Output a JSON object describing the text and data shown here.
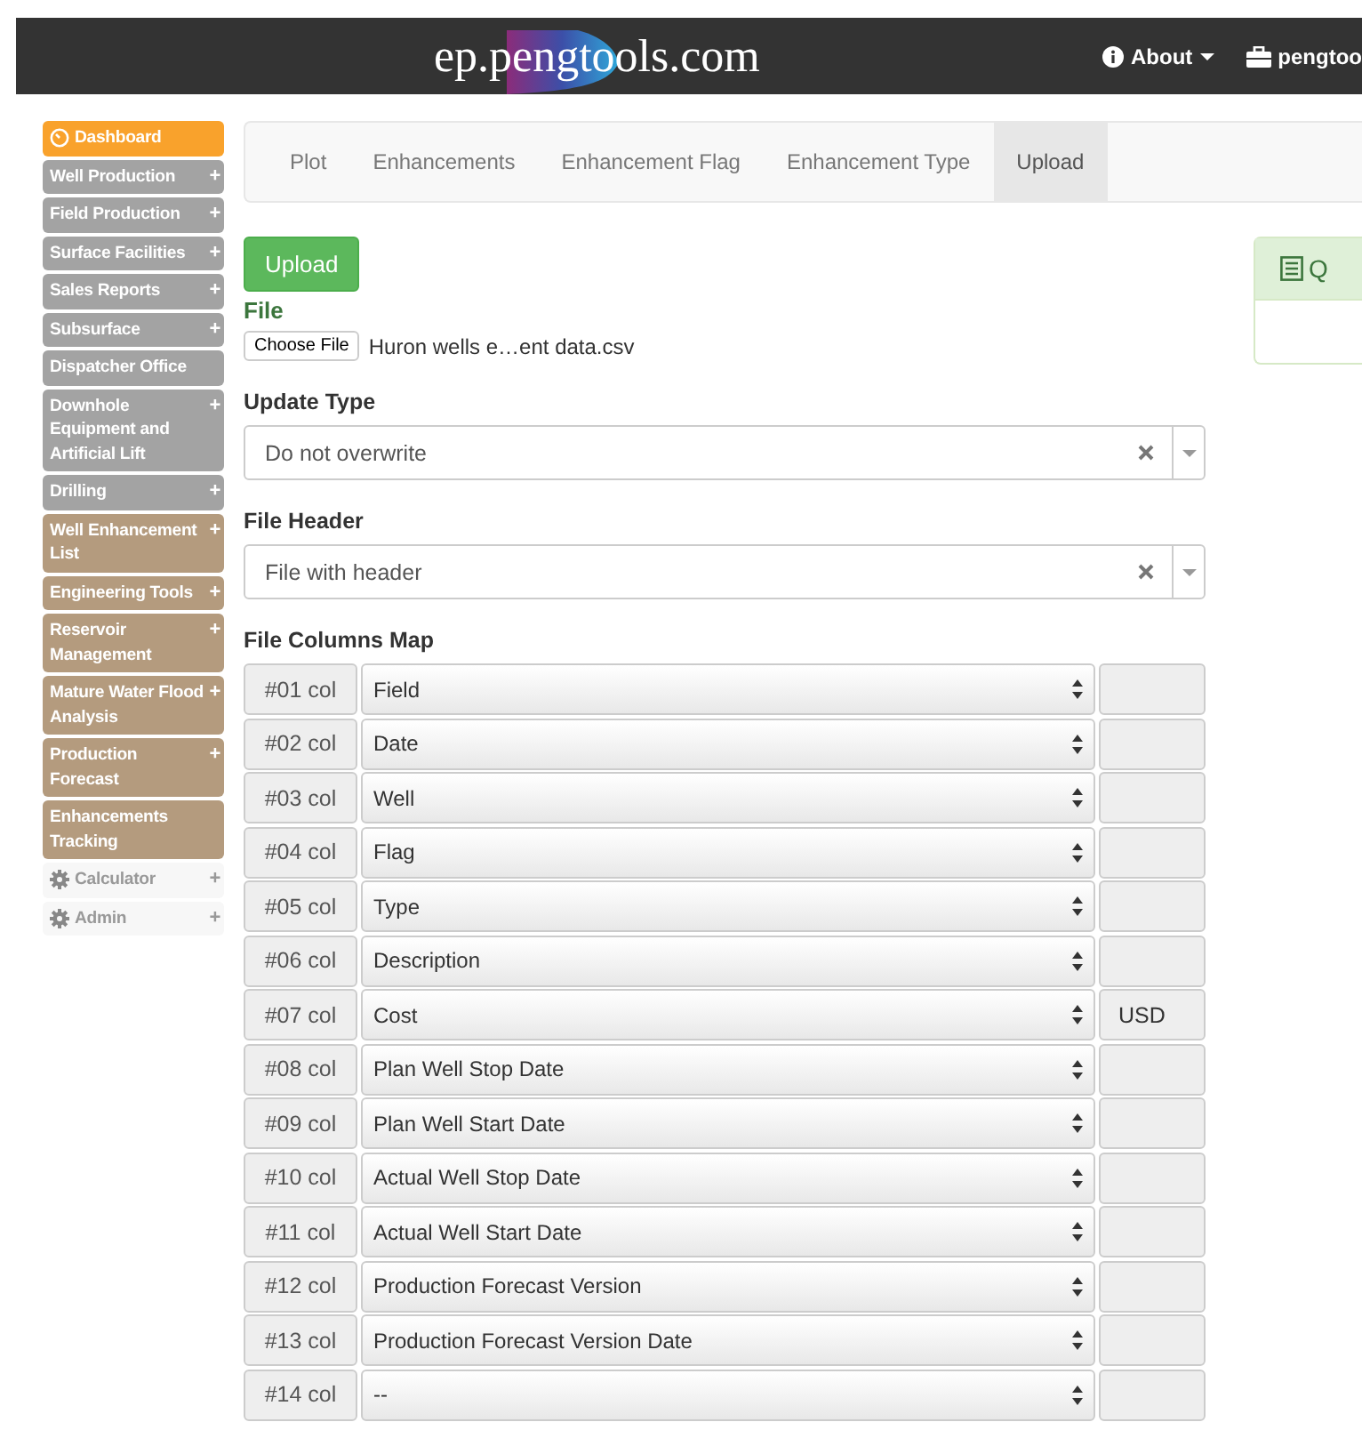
{
  "header": {
    "logo": "ep.pengtools.com",
    "nav": [
      {
        "label": "About",
        "kind": "about"
      },
      {
        "label": "pengtoo",
        "kind": "user"
      }
    ]
  },
  "sidebar": {
    "items": [
      {
        "label": "Dashboard",
        "kind": "dashboard",
        "color": "#f9a22c"
      },
      {
        "label": "Well Production",
        "kind": "group",
        "color": "#a3a3a3",
        "toggle": "+"
      },
      {
        "label": "Field Production",
        "kind": "group",
        "color": "#a3a3a3",
        "toggle": "+"
      },
      {
        "label": "Surface Facilities",
        "kind": "group",
        "color": "#a3a3a3",
        "toggle": "+"
      },
      {
        "label": "Sales Reports",
        "kind": "group",
        "color": "#a3a3a3",
        "toggle": "+"
      },
      {
        "label": "Subsurface",
        "kind": "group",
        "color": "#a3a3a3",
        "toggle": "+"
      },
      {
        "label": "Dispatcher Office",
        "kind": "group",
        "color": "#a3a3a3"
      },
      {
        "label": "Downhole Equipment and Artificial Lift",
        "kind": "group",
        "color": "#a3a3a3",
        "toggle": "+"
      },
      {
        "label": "Drilling",
        "kind": "group",
        "color": "#a3a3a3",
        "toggle": "+"
      },
      {
        "label": "Well Enhancement List",
        "kind": "group",
        "color": "#b49b7e",
        "toggle": "+"
      },
      {
        "label": "Engineering Tools",
        "kind": "group",
        "color": "#b49b7e",
        "toggle": "+"
      },
      {
        "label": "Reservoir Management",
        "kind": "group",
        "color": "#b49b7e",
        "toggle": "+"
      },
      {
        "label": "Mature Water Flood Analysis",
        "kind": "group",
        "color": "#b49b7e",
        "toggle": "+"
      },
      {
        "label": "Production Forecast",
        "kind": "group",
        "color": "#b49b7e",
        "toggle": "+"
      },
      {
        "label": "Enhancements Tracking",
        "kind": "group",
        "color": "#b49b7e"
      },
      {
        "label": "Calculator",
        "kind": "tool",
        "color": "#f7f7f7",
        "toggle": "+"
      },
      {
        "label": "Admin",
        "kind": "tool",
        "color": "#f7f7f7",
        "toggle": "+"
      }
    ]
  },
  "tabs": [
    {
      "label": "Plot",
      "selected": false
    },
    {
      "label": "Enhancements",
      "selected": false
    },
    {
      "label": "Enhancement Flag",
      "selected": false
    },
    {
      "label": "Enhancement Type",
      "selected": false
    },
    {
      "label": "Upload",
      "selected": true
    }
  ],
  "upload_button": "Upload",
  "file": {
    "label": "File",
    "button": "Choose File",
    "filename": "Huron wells e…ent data.csv"
  },
  "update_type": {
    "label": "Update Type",
    "value": "Do not overwrite"
  },
  "file_header": {
    "label": "File Header",
    "value": "File with header"
  },
  "columns_map": {
    "label": "File Columns Map",
    "rows": [
      {
        "col": "#01 col",
        "field": "Field"
      },
      {
        "col": "#02 col",
        "field": "Date"
      },
      {
        "col": "#03 col",
        "field": "Well"
      },
      {
        "col": "#04 col",
        "field": "Flag"
      },
      {
        "col": "#05 col",
        "field": "Type"
      },
      {
        "col": "#06 col",
        "field": "Description"
      },
      {
        "col": "#07 col",
        "field": "Cost",
        "unit": "USD"
      },
      {
        "col": "#08 col",
        "field": "Plan Well Stop Date"
      },
      {
        "col": "#09 col",
        "field": "Plan Well Start Date"
      },
      {
        "col": "#10 col",
        "field": "Actual Well Stop Date"
      },
      {
        "col": "#11 col",
        "field": "Actual Well Start Date"
      },
      {
        "col": "#12 col",
        "field": "Production Forecast Version"
      },
      {
        "col": "#13 col",
        "field": "Production Forecast Version Date"
      },
      {
        "col": "#14 col",
        "field": "--"
      }
    ]
  },
  "side_panel": {
    "title": "Q"
  }
}
